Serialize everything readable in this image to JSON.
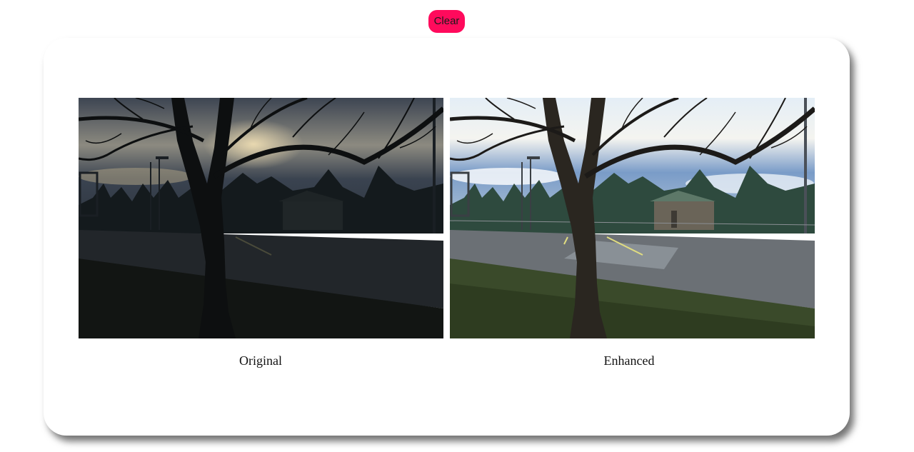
{
  "toolbar": {
    "clear_label": "Clear"
  },
  "images": [
    {
      "caption": "Original",
      "variant": "dark"
    },
    {
      "caption": "Enhanced",
      "variant": "bright"
    }
  ],
  "colors": {
    "clear_button": "#ff0a5c",
    "card_background": "#ffffff"
  }
}
